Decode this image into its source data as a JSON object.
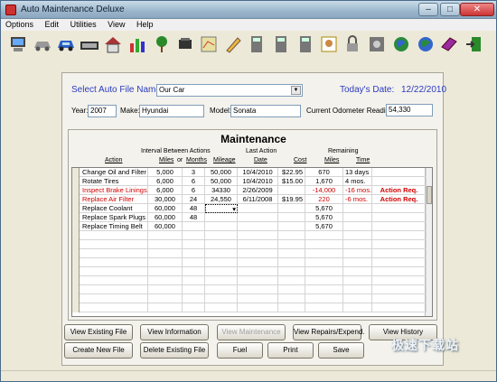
{
  "window": {
    "title": "Auto Maintenance Deluxe"
  },
  "menu": [
    "Options",
    "Edit",
    "Utilities",
    "View",
    "Help"
  ],
  "toolbar_icons": [
    "computer-icon",
    "car-silhouette-icon",
    "car-icon",
    "keyboard-icon",
    "house-icon",
    "bar-chart-icon",
    "tree-icon",
    "tools-icon",
    "map-icon",
    "pencil-icon",
    "calculator-icon",
    "calculator-2-icon",
    "calculator-3-icon",
    "picture-icon",
    "lock-icon",
    "safe-icon",
    "globe-icon",
    "globe-2-icon",
    "book-icon",
    "exit-icon"
  ],
  "auto_file": {
    "label": "Select Auto File Name:",
    "value": "Our Car"
  },
  "today": {
    "label": "Today's Date:",
    "value": "12/22/2010"
  },
  "vehicle": {
    "year_label": "Year:",
    "year": "2007",
    "make_label": "Make:",
    "make": "Hyundai",
    "model_label": "Model:",
    "model": "Sonata",
    "odometer_label": "Current Odometer Reading:",
    "odometer": "54,330"
  },
  "maintenance": {
    "title": "Maintenance",
    "group_headers": {
      "interval": "Interval Between Actions",
      "last": "Last Action",
      "remaining": "Remaining"
    },
    "columns": {
      "action": "Action",
      "miles": "Miles",
      "or": "or",
      "months": "Months",
      "mileage": "Mileage",
      "date": "Date",
      "cost": "Cost",
      "rem_miles": "Miles",
      "rem_time": "Time"
    },
    "rows": [
      {
        "action": "Change Oil and Filter",
        "miles": "5,000",
        "months": "3",
        "mileage": "50,000",
        "date": "10/4/2010",
        "cost": "$22.95",
        "rem_miles": "670",
        "rem_time": "13 days",
        "status": "",
        "alert": false
      },
      {
        "action": "Rotate Tires",
        "miles": "6,000",
        "months": "6",
        "mileage": "50,000",
        "date": "10/4/2010",
        "cost": "$15.00",
        "rem_miles": "1,670",
        "rem_time": "4 mos.",
        "status": "",
        "alert": false
      },
      {
        "action": "Inspect Brake Linings",
        "miles": "6,000",
        "months": "6",
        "mileage": "34330",
        "date": "2/26/2009",
        "cost": "",
        "rem_miles": "-14,000",
        "rem_time": "-16 mos.",
        "status": "Action Req.",
        "alert": true
      },
      {
        "action": "Replace Air Filter",
        "miles": "30,000",
        "months": "24",
        "mileage": "24,550",
        "date": "6/11/2008",
        "cost": "$19.95",
        "rem_miles": "220",
        "rem_time": "-6 mos.",
        "status": "Action Req.",
        "alert": true
      },
      {
        "action": "Replace Coolant",
        "miles": "60,000",
        "months": "48",
        "mileage": "",
        "date": "",
        "cost": "",
        "rem_miles": "5,670",
        "rem_time": "",
        "status": "",
        "alert": false
      },
      {
        "action": "Replace Spark Plugs",
        "miles": "60,000",
        "months": "48",
        "mileage": "",
        "date": "",
        "cost": "",
        "rem_miles": "5,670",
        "rem_time": "",
        "status": "",
        "alert": false
      },
      {
        "action": "Replace Timing Belt",
        "miles": "60,000",
        "months": "",
        "mileage": "",
        "date": "",
        "cost": "",
        "rem_miles": "5,670",
        "rem_time": "",
        "status": "",
        "alert": false
      }
    ],
    "empty_rows": 9
  },
  "buttons": {
    "view_existing": "View Existing File",
    "view_information": "View Information",
    "view_maintenance": "View Maintenance",
    "view_repairs": "View Repairs/Expend.",
    "view_history": "View History",
    "create_new": "Create New File",
    "delete_existing": "Delete Existing File",
    "fuel": "Fuel",
    "print": "Print",
    "save": "Save"
  },
  "watermark": "极速下载站",
  "colors": {
    "alert": "#d00000",
    "label_blue": "#2a3bbf"
  }
}
